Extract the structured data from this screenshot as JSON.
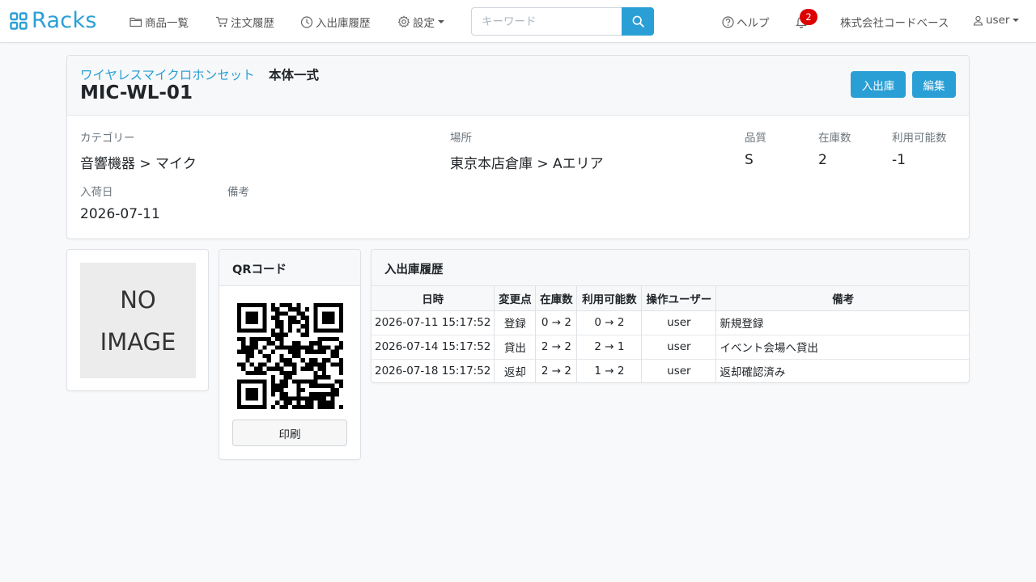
{
  "navbar": {
    "brand": "Racks",
    "links": {
      "products": "商品一覧",
      "orders": "注文履歴",
      "stock_history": "入出庫履歴",
      "settings": "設定"
    },
    "search_placeholder": "キーワード",
    "help": "ヘルプ",
    "notification_count": "2",
    "company": "株式会社コードベース",
    "user": "user"
  },
  "product": {
    "name": "ワイヤレスマイクロホンセット",
    "variant": "本体一式",
    "code": "MIC-WL-01",
    "buttons": {
      "stock": "入出庫",
      "edit": "編集"
    },
    "fields": {
      "category_label": "カテゴリー",
      "category_value": "音響機器 > マイク",
      "location_label": "場所",
      "location_value": "東京本店倉庫 > Aエリア",
      "quality_label": "品質",
      "quality_value": "S",
      "stock_label": "在庫数",
      "stock_value": "2",
      "available_label": "利用可能数",
      "available_value": "-1",
      "arrival_label": "入荷日",
      "arrival_value": "2026-07-11",
      "note_label": "備考",
      "note_value": ""
    }
  },
  "image": {
    "placeholder_line1": "NO",
    "placeholder_line2": "IMAGE"
  },
  "qr": {
    "title": "QRコード",
    "print_label": "印刷"
  },
  "history": {
    "title": "入出庫履歴",
    "headers": [
      "日時",
      "変更点",
      "在庫数",
      "利用可能数",
      "操作ユーザー",
      "備考"
    ],
    "rows": [
      [
        "2026-07-11 15:17:52",
        "登録",
        "0 → 2",
        "0 → 2",
        "user",
        "新規登録"
      ],
      [
        "2026-07-14 15:17:52",
        "貸出",
        "2 → 2",
        "2 → 1",
        "user",
        "イベント会場へ貸出"
      ],
      [
        "2026-07-18 15:17:52",
        "返却",
        "2 → 2",
        "1 → 2",
        "user",
        "返却確認済み"
      ]
    ]
  },
  "colors": {
    "accent": "#2a9fd6",
    "badge": "#dc0000"
  }
}
